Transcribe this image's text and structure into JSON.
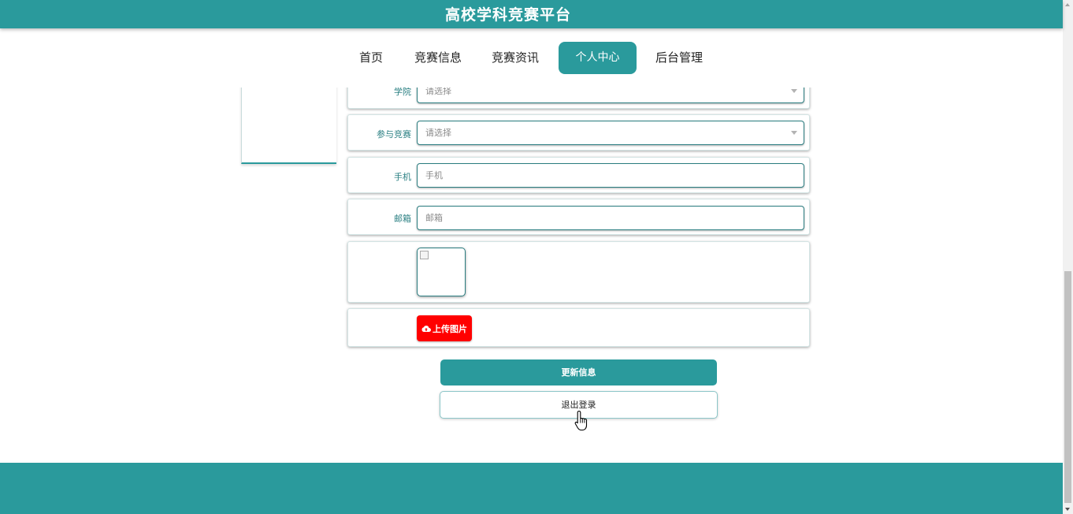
{
  "header": {
    "site_title": "高校学科竞赛平台"
  },
  "nav": {
    "items": [
      {
        "label": "首页"
      },
      {
        "label": "竞赛信息"
      },
      {
        "label": "竞赛资讯"
      },
      {
        "label": "个人中心",
        "active": true
      },
      {
        "label": "后台管理"
      }
    ]
  },
  "form": {
    "college": {
      "label": "学院",
      "placeholder": "请选择"
    },
    "competition": {
      "label": "参与竞赛",
      "placeholder": "请选择"
    },
    "phone": {
      "label": "手机",
      "placeholder": "手机",
      "value": ""
    },
    "email": {
      "label": "邮箱",
      "placeholder": "邮箱",
      "value": ""
    },
    "upload_label": "上传图片"
  },
  "actions": {
    "update_label": "更新信息",
    "logout_label": "退出登录"
  },
  "icons": {
    "upload": "cloud-upload-icon",
    "cursor": "hand-pointer-icon",
    "image": "broken-image-icon"
  },
  "colors": {
    "primary": "#2a9a9c",
    "upload_button": "#ff0000",
    "label_text": "#2a7f82"
  }
}
